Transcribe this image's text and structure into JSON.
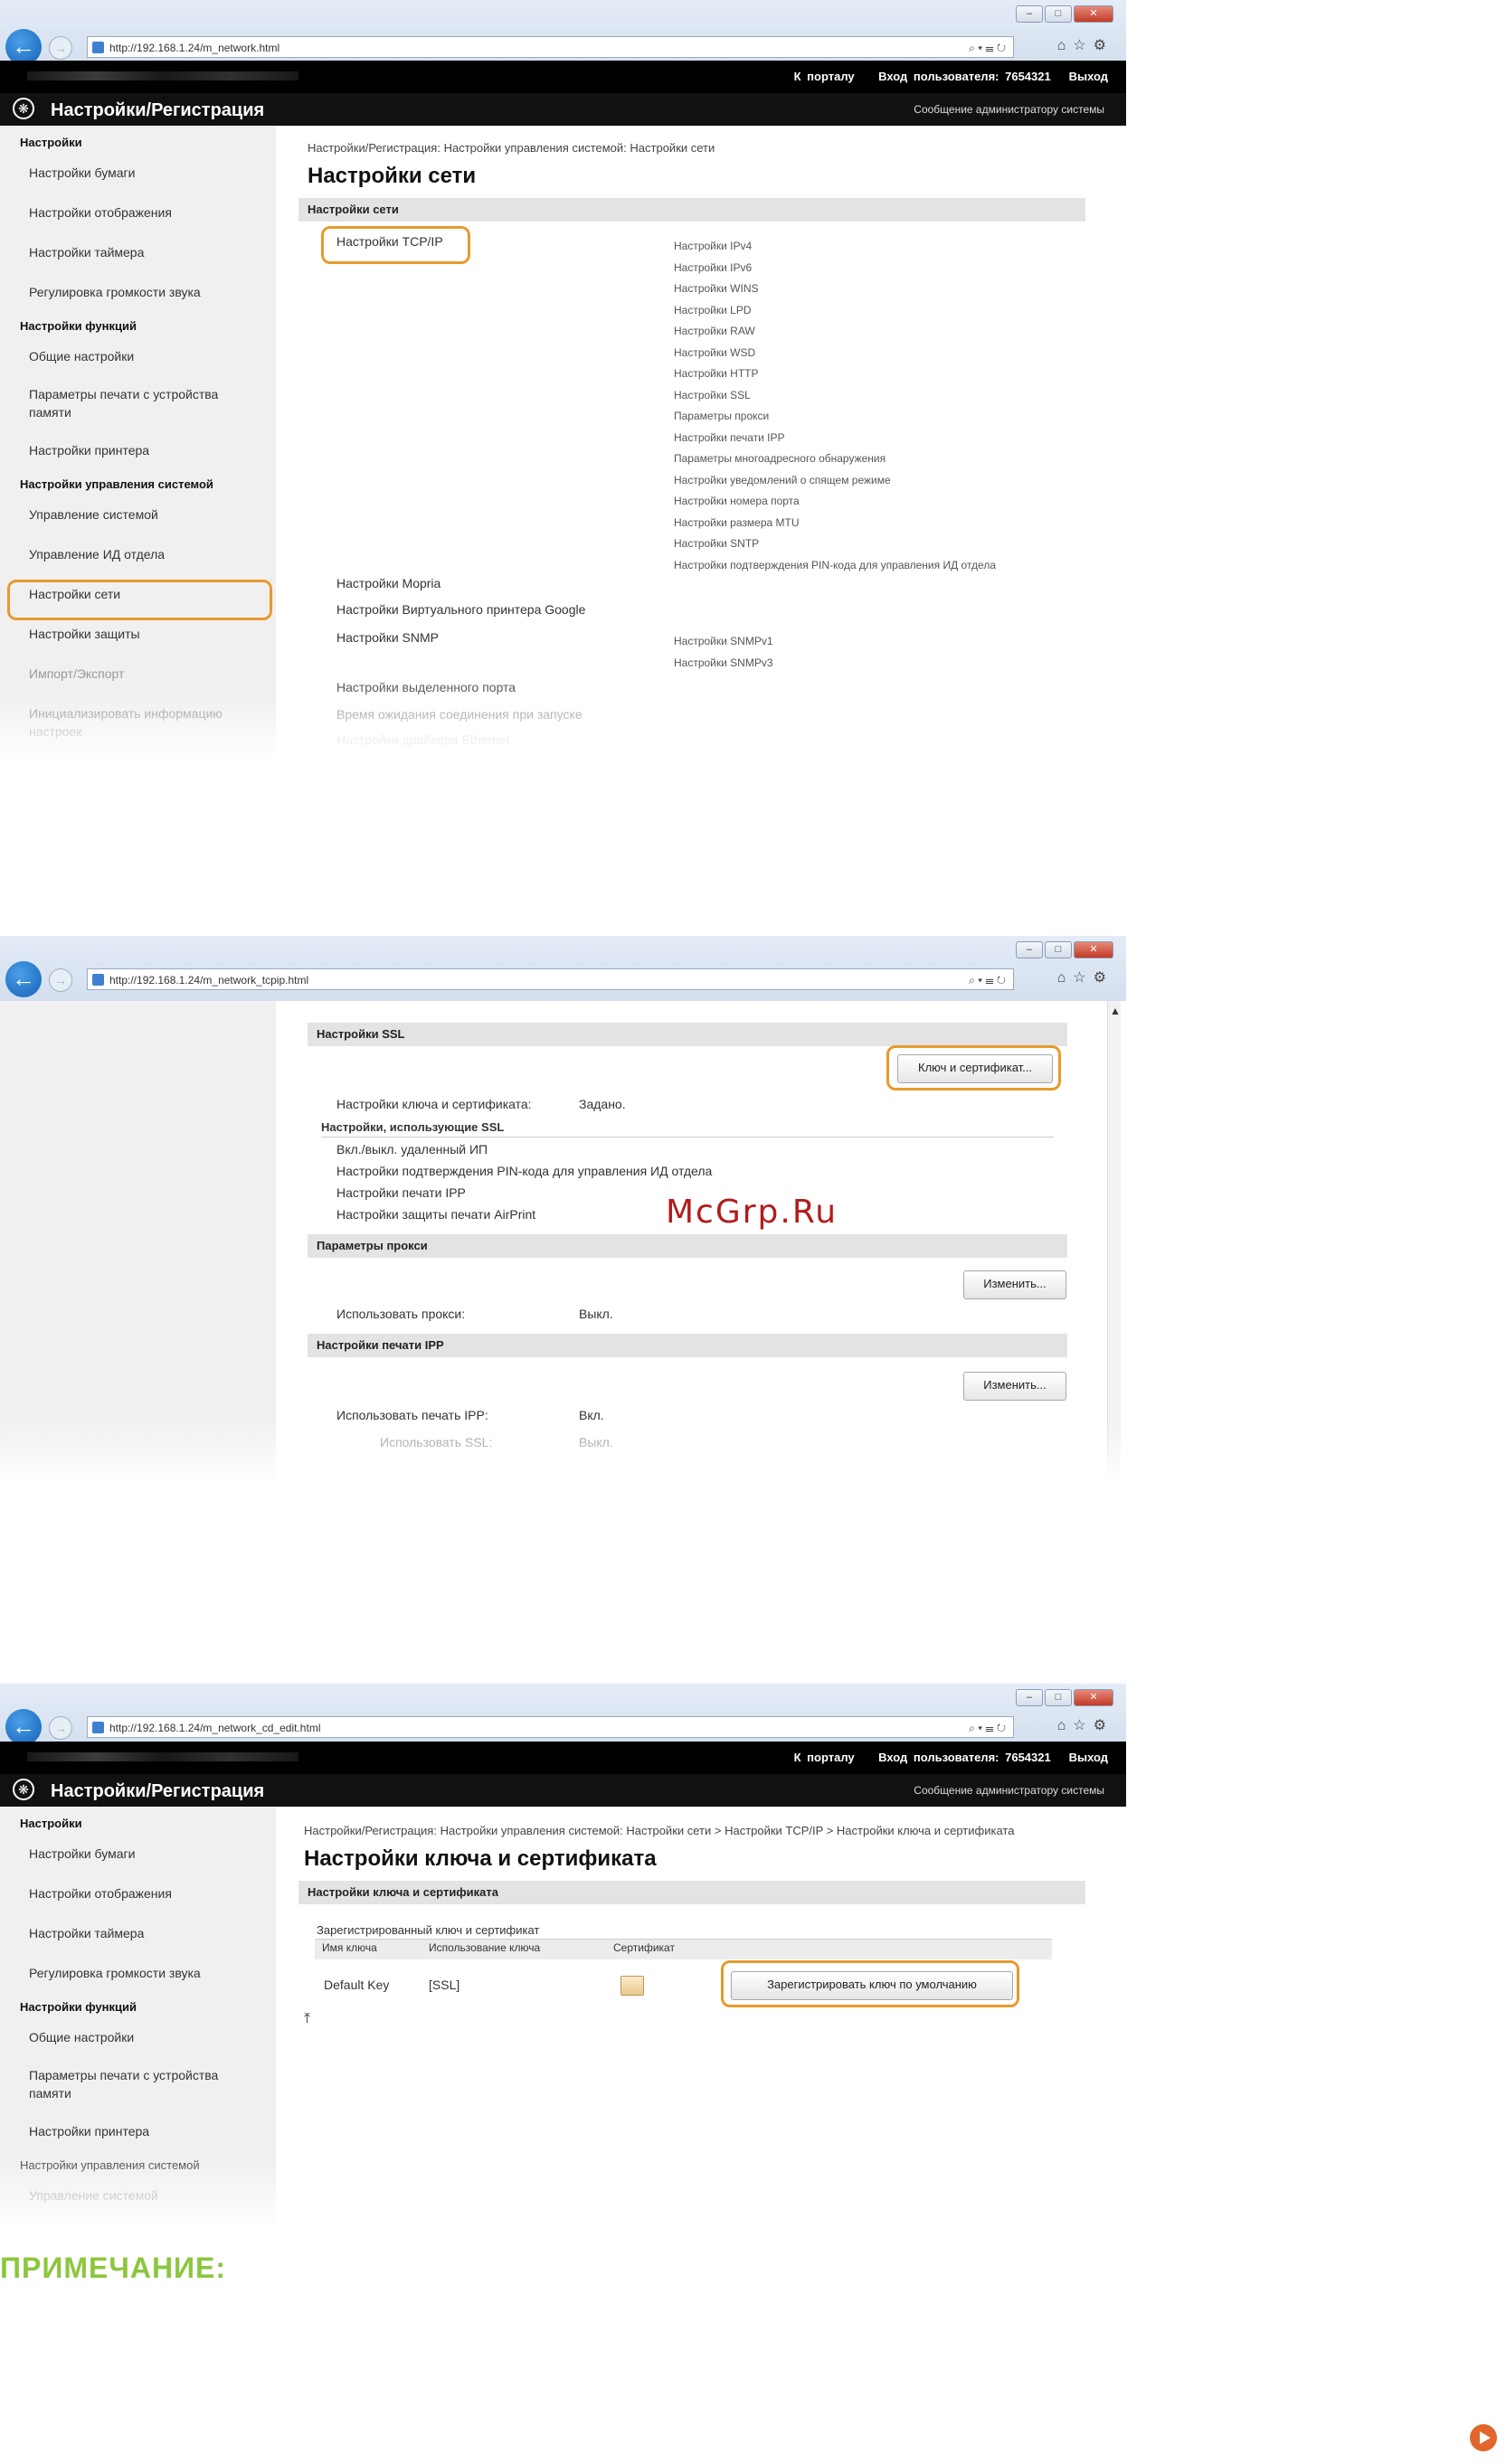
{
  "browser": {
    "url1": "http://192.168.1.24/m_network.html",
    "url2": "http://192.168.1.24/m_network_tcpip.html",
    "url3": "http://192.168.1.24/m_network_cd_edit.html",
    "addr_tools": "⌕ ▾ ☰ ↻",
    "win_min": "–",
    "win_max": "□",
    "win_close": "✕",
    "nav_tools": "⌂☆⚙"
  },
  "topbar": {
    "portal": "К порталу",
    "user": "Вход пользователя:",
    "user_id": "7654321",
    "logout": "Выход"
  },
  "appbar": {
    "title": "Настройки/Регистрация",
    "msg": "Сообщение администратору системы"
  },
  "sidebar1": {
    "g1": "Настройки",
    "i1": "Настройки бумаги",
    "i2": "Настройки отображения",
    "i3": "Настройки таймера",
    "i4": "Регулировка громкости звука",
    "g2": "Настройки функций",
    "i5": "Общие настройки",
    "i6": "Параметры печати с устройства памяти",
    "i7": "Настройки принтера",
    "g3": "Настройки управления системой",
    "i8": "Управление системой",
    "i9": "Управление ИД отдела",
    "i10": "Настройки сети",
    "i11": "Настройки защиты",
    "i12": "Импорт/Экспорт",
    "i13": "Инициализировать информацию настроек"
  },
  "screen1": {
    "crumb": "Настройки/Регистрация: Настройки управления системой: Настройки сети",
    "title": "Настройки сети",
    "section": "Настройки сети",
    "tcpip": "Настройки TCP/IP",
    "tcpip_subs": [
      "Настройки IPv4",
      "Настройки IPv6",
      "Настройки WINS",
      "Настройки LPD",
      "Настройки RAW",
      "Настройки WSD",
      "Настройки HTTP",
      "Настройки SSL",
      "Параметры прокси",
      "Настройки печати IPP",
      "Параметры многоадресного обнаружения",
      "Настройки уведомлений о спящем режиме",
      "Настройки номера порта",
      "Настройки размера MTU",
      "Настройки SNTP",
      "Настройки подтверждения PIN-кода для управления ИД отдела"
    ],
    "mopria": "Настройки Mopria",
    "google": "Настройки Виртуального принтера Google",
    "snmp": "Настройки SNMP",
    "snmp_subs": [
      "Настройки SNMPv1",
      "Настройки SNMPv3"
    ],
    "dedicated": "Настройки выделенного порта",
    "wait": "Время ожидания соединения при запуске",
    "ethernet": "Настройки драйвера Ethernet"
  },
  "screen2": {
    "ssl_section": "Настройки SSL",
    "key_button": "Ключ и сертификат...",
    "key_label": "Настройки ключа и сертификата:",
    "key_value": "Задано.",
    "uses_title": "Настройки, использующие SSL",
    "uses": [
      "Вкл./выкл. удаленный ИП",
      "Настройки подтверждения PIN-кода для управления ИД отдела",
      "Настройки печати IPP",
      "Настройки защиты печати AirPrint"
    ],
    "proxy_section": "Параметры прокси",
    "change_button": "Изменить...",
    "proxy_label": "Использовать прокси:",
    "proxy_value": "Выкл.",
    "ipp_section": "Настройки печати IPP",
    "ipp_label": "Использовать печать IPP:",
    "ipp_value": "Вкл.",
    "ssl_label": "Использовать SSL:",
    "ssl_value": "Выкл.",
    "scroll_up": "▲"
  },
  "watermark": "McGrp.Ru",
  "sidebar3": {
    "g1": "Настройки",
    "i1": "Настройки бумаги",
    "i2": "Настройки отображения",
    "i3": "Настройки таймера",
    "i4": "Регулировка громкости звука",
    "g2": "Настройки функций",
    "i5": "Общие настройки",
    "i6": "Параметры печати с устройства памяти",
    "i7": "Настройки принтера",
    "g3": "Настройки управления системой",
    "i8": "Управление системой"
  },
  "screen3": {
    "crumb": "Настройки/Регистрация: Настройки управления системой: Настройки сети > Настройки TCP/IP > Настройки ключа и сертификата",
    "title": "Настройки ключа и сертификата",
    "section": "Настройки ключа и сертификата",
    "registered": "Зарегистрированный ключ и сертификат",
    "col_name": "Имя ключа",
    "col_use": "Использование ключа",
    "col_cert": "Сертификат",
    "key_name": "Default Key",
    "key_use": "[SSL]",
    "register_button": "Зарегистрировать ключ по умолчанию",
    "to_top": "⤒"
  },
  "note_title": "ПРИМЕЧАНИЕ:"
}
